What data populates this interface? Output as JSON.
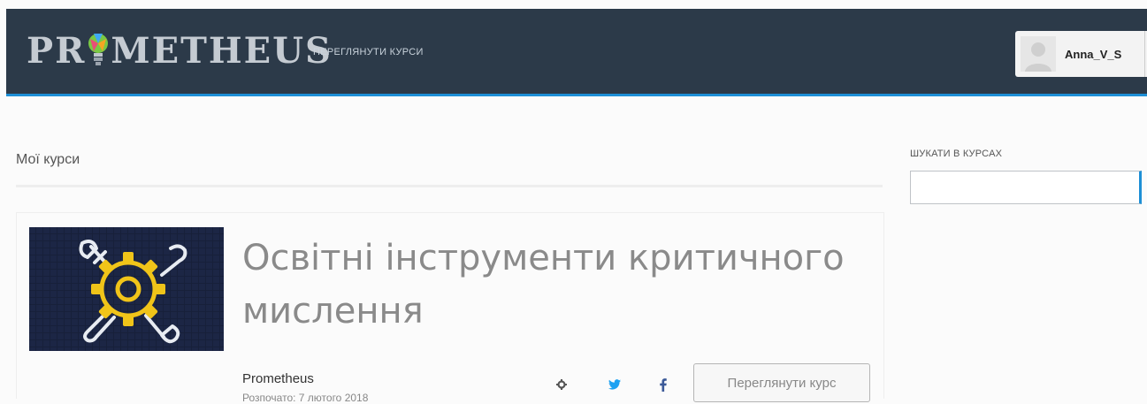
{
  "header": {
    "logo_text_left": "PR",
    "logo_text_right": "METHEUS",
    "nav_link": "ПЕРЕГЛЯНУТИ КУРСИ",
    "username": "Anna_V_S"
  },
  "main": {
    "page_title": "Мої курси"
  },
  "sidebar": {
    "search_label": "ШУКАТИ В КУРСАХ",
    "search_value": ""
  },
  "course": {
    "title": "Освітні інструменти критичного мислення",
    "organization": "Prometheus",
    "date_partial": "Розпочато: 7 лютого 2018",
    "view_button": "Переглянути курс",
    "icons": [
      "gear-icon",
      "twitter-icon",
      "facebook-icon"
    ]
  },
  "colors": {
    "header_bg": "#2c3a49",
    "accent": "#1d8fd6",
    "twitter": "#1da1f2",
    "facebook": "#3b5998"
  }
}
